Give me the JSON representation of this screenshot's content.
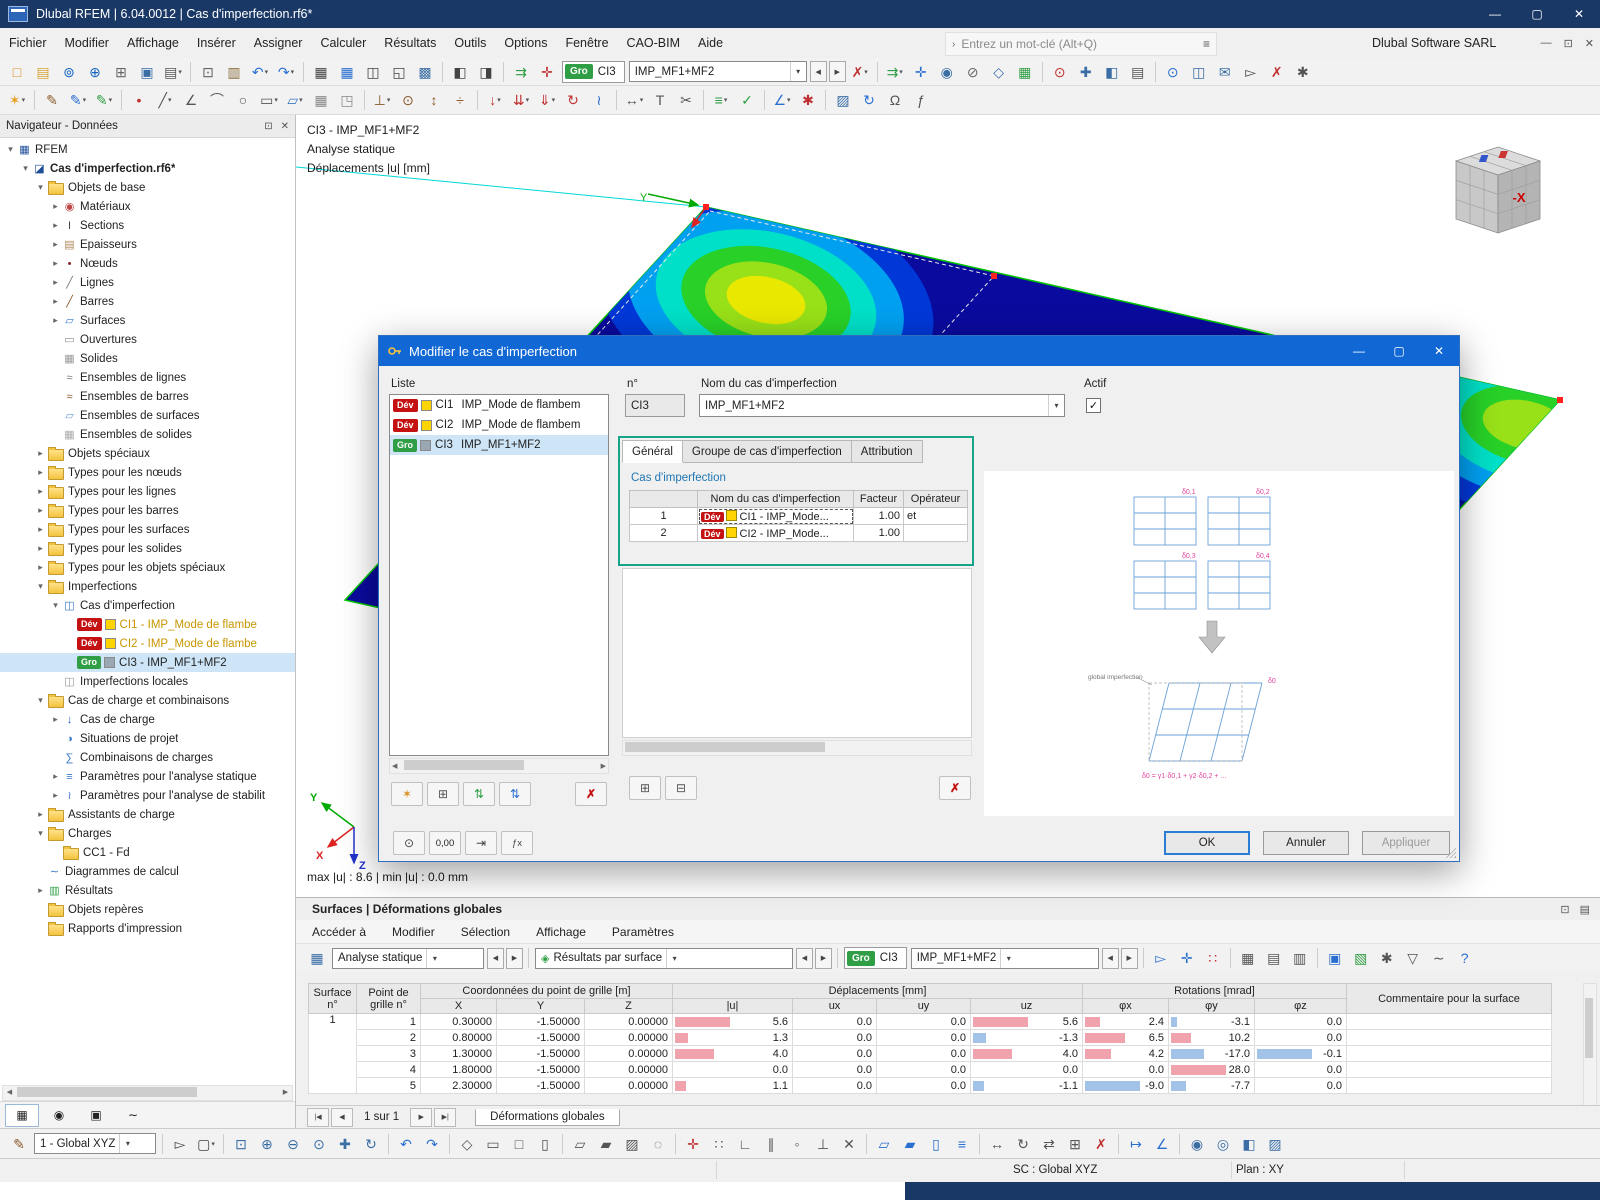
{
  "titlebar": {
    "title": "Dlubal RFEM | 6.04.0012 | Cas d'imperfection.rf6*"
  },
  "menubar": {
    "items": [
      "Fichier",
      "Modifier",
      "Affichage",
      "Insérer",
      "Assigner",
      "Calculer",
      "Résultats",
      "Outils",
      "Options",
      "Fenêtre",
      "CAO-BIM",
      "Aide"
    ],
    "search_placeholder": "Entrez un mot-clé (Alt+Q)",
    "brand": "Dlubal Software SARL"
  },
  "toolbar_combo": {
    "badge": "Gro",
    "id": "CI3",
    "name": "IMP_MF1+MF2"
  },
  "toolbars": {
    "t1a": [
      [
        "new-model",
        "□",
        "#d89020"
      ],
      [
        "open-model",
        "▤",
        "#d8a53a"
      ],
      [
        "teamwork",
        "⊚",
        "#1565c0"
      ],
      [
        "dlubal-center",
        "⊕",
        "#1565c0"
      ],
      [
        "copy-model",
        "⊞",
        "#666666"
      ],
      [
        "save-model",
        "▣",
        "#3a6ea5"
      ],
      [
        "print-graphic",
        "▤",
        "#555555",
        "dd"
      ],
      "|",
      [
        "copy-object",
        "⊡",
        "#666666"
      ],
      [
        "printout-report",
        "▥",
        "#8a6d3b"
      ],
      [
        "undo",
        "↶",
        "#2a6fd0",
        "dd"
      ],
      [
        "redo",
        "↷",
        "#2a6fd0",
        "dd"
      ],
      "|",
      [
        "table-view",
        "▦",
        "#444444"
      ],
      [
        "table-layout",
        "▦",
        "#2a6fd0"
      ],
      [
        "table-dock",
        "◫",
        "#444444"
      ],
      [
        "fullscreen",
        "◱",
        "#444444"
      ],
      [
        "snap-settings",
        "▩",
        "#3a6ea5"
      ],
      "|",
      [
        "navigator-toggle",
        "◧",
        "#444444"
      ],
      [
        "panel-toggle",
        "◨",
        "#444444"
      ],
      "|",
      [
        "load-direction",
        "⇉",
        "#2f9e44"
      ],
      [
        "axes-toggle",
        "✛",
        "#c03030"
      ]
    ],
    "t1b": [
      [
        "delete-results",
        "✗",
        "#c03030",
        "dd"
      ],
      "|",
      [
        "show-results",
        "⇉",
        "#2f9e44",
        "dd"
      ],
      [
        "result-values",
        "✛",
        "#2a6fd0"
      ],
      [
        "visibility",
        "◉",
        "#3a6ea5"
      ],
      [
        "clipping-box",
        "⊘",
        "#666666"
      ],
      [
        "user-view",
        "◇",
        "#3a6ea5"
      ],
      [
        "goto-table",
        "▦",
        "#2f9e44"
      ],
      "|",
      [
        "zoom-select",
        "⊙",
        "#c03030"
      ],
      [
        "move-view",
        "✚",
        "#3a6ea5"
      ],
      [
        "box-3d",
        "◧",
        "#3a6ea5"
      ],
      [
        "print-view",
        "▤",
        "#555555"
      ],
      "|",
      [
        "find-object",
        "⊙",
        "#2a6fd0"
      ],
      [
        "block-manager",
        "◫",
        "#3a6ea5"
      ],
      [
        "send-mail",
        "✉",
        "#3a6ea5"
      ],
      [
        "selection-pointer",
        "▻",
        "#444444"
      ],
      [
        "delete-all",
        "✗",
        "#c03030"
      ],
      [
        "options-gear",
        "✱",
        "#555555"
      ]
    ],
    "t2": [
      [
        "favorites",
        "✶",
        "#e8a020",
        "dd"
      ],
      "|",
      [
        "edit-node",
        "✎",
        "#8a5a2a"
      ],
      [
        "edit-line",
        "✎",
        "#2a6fd0",
        "dd"
      ],
      [
        "edit-surface",
        "✎",
        "#2f9e44",
        "dd"
      ],
      "|",
      [
        "new-node",
        "•",
        "#c03030"
      ],
      [
        "new-line",
        "╱",
        "#555555",
        "dd"
      ],
      [
        "new-polyline",
        "∠",
        "#555555"
      ],
      [
        "new-arc",
        "⌒",
        "#555555"
      ],
      [
        "new-circle",
        "○",
        "#555555"
      ],
      [
        "new-rectangle",
        "▭",
        "#555555",
        "dd"
      ],
      [
        "new-surface",
        "▱",
        "#3a78c8",
        "dd"
      ],
      [
        "new-solid",
        "▦",
        "#8a8a8a"
      ],
      [
        "new-opening",
        "◳",
        "#8a8a8a"
      ],
      "|",
      [
        "new-support",
        "⊥",
        "#8a5a2a",
        "dd"
      ],
      [
        "new-hinge",
        "⊙",
        "#8a5a2a"
      ],
      [
        "member-eccentricity",
        "↕",
        "#8a5a2a"
      ],
      [
        "member-division",
        "÷",
        "#8a5a2a"
      ],
      "|",
      [
        "nodal-load",
        "↓",
        "#c03030",
        "dd"
      ],
      [
        "line-load",
        "⇊",
        "#c03030",
        "dd"
      ],
      [
        "surface-load",
        "⇓",
        "#c03030",
        "dd"
      ],
      [
        "moment-load",
        "↻",
        "#c03030"
      ],
      [
        "imperfection-tool",
        "≀",
        "#2a6fd0"
      ],
      "|",
      [
        "dimension",
        "↔",
        "#555555",
        "dd"
      ],
      [
        "text-comment",
        "T",
        "#555555"
      ],
      [
        "section-cut",
        "✂",
        "#555555"
      ],
      "|",
      [
        "calculate-all",
        "≡",
        "#2f9e44",
        "dd"
      ],
      [
        "check-model",
        "✓",
        "#2f9e44"
      ],
      "|",
      [
        "measure",
        "∠",
        "#2a6fd0",
        "dd"
      ],
      [
        "default-settings",
        "✱",
        "#c03030"
      ],
      "|",
      [
        "display-properties",
        "▨",
        "#3a6ea5"
      ],
      [
        "regenerate",
        "↻",
        "#2a6fd0"
      ],
      [
        "units",
        "Ω",
        "#555555"
      ],
      [
        "formula",
        "ƒ",
        "#555555"
      ]
    ],
    "bt": [
      [
        "select-pointer",
        "▻",
        "#444444"
      ],
      [
        "select-window",
        "▢",
        "#444444",
        "dd"
      ],
      "|",
      [
        "zoom-window",
        "⊡",
        "#3a6ea5"
      ],
      [
        "zoom-in",
        "⊕",
        "#3a6ea5"
      ],
      [
        "zoom-out",
        "⊖",
        "#3a6ea5"
      ],
      [
        "zoom-all",
        "⊙",
        "#3a6ea5"
      ],
      [
        "pan-view",
        "✚",
        "#3a6ea5"
      ],
      [
        "orbit-view",
        "↻",
        "#3a6ea5"
      ],
      "|",
      [
        "previous-view",
        "↶",
        "#2a6fd0"
      ],
      [
        "next-view",
        "↷",
        "#2a6fd0"
      ],
      "|",
      [
        "view-isometric",
        "◇",
        "#555555"
      ],
      [
        "view-top",
        "▭",
        "#555555"
      ],
      [
        "view-front",
        "□",
        "#555555"
      ],
      [
        "view-side",
        "▯",
        "#555555"
      ],
      "|",
      [
        "display-wireframe",
        "▱",
        "#555555"
      ],
      [
        "display-shaded",
        "▰",
        "#555555"
      ],
      [
        "display-hidden",
        "▨",
        "#555555"
      ],
      [
        "display-transparent",
        "◌",
        "#555555"
      ],
      "|",
      [
        "snap-node",
        "✛",
        "#c03030"
      ],
      [
        "snap-grid",
        "∷",
        "#555555"
      ],
      [
        "snap-ortho",
        "∟",
        "#555555"
      ],
      [
        "snap-guidelines",
        "∥",
        "#555555"
      ],
      [
        "snap-midpoint",
        "◦",
        "#555555"
      ],
      [
        "snap-perpendicular",
        "⊥",
        "#555555"
      ],
      [
        "snap-intersection",
        "✕",
        "#555555"
      ],
      "|",
      [
        "work-plane-xy",
        "▱",
        "#2a6fd0"
      ],
      [
        "work-plane-xz",
        "▰",
        "#2a6fd0"
      ],
      [
        "work-plane-yz",
        "▯",
        "#2a6fd0"
      ],
      [
        "plane-offset",
        "≡",
        "#2a6fd0"
      ],
      "|",
      [
        "move-object",
        "↔",
        "#555555"
      ],
      [
        "rotate-object",
        "↻",
        "#555555"
      ],
      [
        "mirror-object",
        "⇄",
        "#555555"
      ],
      [
        "copy-object-2",
        "⊞",
        "#555555"
      ],
      [
        "delete-object",
        "✗",
        "#c03030"
      ],
      "|",
      [
        "measure-distance",
        "↦",
        "#2a6fd0"
      ],
      [
        "measure-angle",
        "∠",
        "#2a6fd0"
      ],
      "|",
      [
        "visibility-by-window",
        "◉",
        "#3a6ea5"
      ],
      [
        "visibility-by-object",
        "◎",
        "#3a6ea5"
      ],
      [
        "render-mode",
        "◧",
        "#3a6ea5"
      ],
      [
        "background-settings",
        "▨",
        "#3a6ea5"
      ]
    ],
    "rt": [
      [
        "result-pick",
        "▻",
        "#2a6fd0"
      ],
      [
        "result-pick-values",
        "✛",
        "#2a6fd0"
      ],
      [
        "pointer-values",
        "∷",
        "#c03030"
      ],
      "|",
      [
        "table-grid",
        "▦",
        "#555555"
      ],
      [
        "table-export",
        "▤",
        "#555555"
      ],
      [
        "table-print",
        "▥",
        "#555555"
      ],
      "|",
      [
        "table-save",
        "▣",
        "#2a6fd0"
      ],
      [
        "table-excel",
        "▧",
        "#2f9e44"
      ],
      [
        "table-settings",
        "✱",
        "#555555"
      ],
      [
        "table-filter",
        "▽",
        "#555555"
      ],
      [
        "table-chart",
        "∼",
        "#555555"
      ],
      [
        "table-help",
        "?",
        "#2a6fd0"
      ]
    ],
    "list_tb": [
      [
        "new-imperfection-case",
        "✶",
        "#d89020"
      ],
      [
        "copy-imperfection-case",
        "⊞",
        "#555555"
      ],
      [
        "check-all-cases",
        "⇅",
        "#2f9e44"
      ],
      [
        "sort-cases",
        "⇅",
        "#2a6fd0"
      ]
    ],
    "table_tb": [
      [
        "insert-row",
        "⊞",
        "#555555"
      ],
      [
        "remove-row",
        "⊟",
        "#555555"
      ]
    ]
  },
  "navigator": {
    "title": "Navigateur - Données",
    "tree": [
      {
        "t": "RFEM",
        "l": 0,
        "e": "v",
        "i": "rfem"
      },
      {
        "t": "Cas d'imperfection.rf6*",
        "l": 1,
        "e": "v",
        "i": "model",
        "bold": true
      },
      {
        "t": "Objets de base",
        "l": 2,
        "e": "v",
        "i": "folder"
      },
      {
        "t": "Matériaux",
        "l": 3,
        "e": "r",
        "i": "materials"
      },
      {
        "t": "Sections",
        "l": 3,
        "e": "r",
        "i": "sections"
      },
      {
        "t": "Épaisseurs",
        "l": 3,
        "e": "r",
        "i": "thickness"
      },
      {
        "t": "Nœuds",
        "l": 3,
        "e": "r",
        "i": "nodes"
      },
      {
        "t": "Lignes",
        "l": 3,
        "e": "r",
        "i": "lines"
      },
      {
        "t": "Barres",
        "l": 3,
        "e": "r",
        "i": "members"
      },
      {
        "t": "Surfaces",
        "l": 3,
        "e": "r",
        "i": "surfaces"
      },
      {
        "t": "Ouvertures",
        "l": 3,
        "e": "",
        "i": "openings"
      },
      {
        "t": "Solides",
        "l": 3,
        "e": "",
        "i": "solids"
      },
      {
        "t": "Ensembles de lignes",
        "l": 3,
        "e": "",
        "i": "setlines"
      },
      {
        "t": "Ensembles de barres",
        "l": 3,
        "e": "",
        "i": "setmembers"
      },
      {
        "t": "Ensembles de surfaces",
        "l": 3,
        "e": "",
        "i": "setsurfaces"
      },
      {
        "t": "Ensembles de solides",
        "l": 3,
        "e": "",
        "i": "setsolids"
      },
      {
        "t": "Objets spéciaux",
        "l": 2,
        "e": "r",
        "i": "folder"
      },
      {
        "t": "Types pour les nœuds",
        "l": 2,
        "e": "r",
        "i": "folder"
      },
      {
        "t": "Types pour les lignes",
        "l": 2,
        "e": "r",
        "i": "folder"
      },
      {
        "t": "Types pour les barres",
        "l": 2,
        "e": "r",
        "i": "folder"
      },
      {
        "t": "Types pour les surfaces",
        "l": 2,
        "e": "r",
        "i": "folder"
      },
      {
        "t": "Types pour les solides",
        "l": 2,
        "e": "r",
        "i": "folder"
      },
      {
        "t": "Types pour les objets spéciaux",
        "l": 2,
        "e": "r",
        "i": "folder"
      },
      {
        "t": "Imperfections",
        "l": 2,
        "e": "v",
        "i": "folder"
      },
      {
        "t": "Cas d'imperfection",
        "l": 3,
        "e": "v",
        "i": "impcase"
      },
      {
        "t": "CI1 - IMP_Mode de flambe",
        "l": 4,
        "b": "Dév",
        "bc": "#c41212",
        "sq": "#ffd400",
        "col": "#c79600"
      },
      {
        "t": "CI2 - IMP_Mode de flambe",
        "l": 4,
        "b": "Dév",
        "bc": "#c41212",
        "sq": "#ffd400",
        "col": "#c79600"
      },
      {
        "t": "CI3 - IMP_MF1+MF2",
        "l": 4,
        "b": "Gro",
        "bc": "#2f9e44",
        "sq": "#9aa7b3",
        "sel": true
      },
      {
        "t": "Imperfections locales",
        "l": 3,
        "e": "",
        "i": "implocal"
      },
      {
        "t": "Cas de charge et combinaisons",
        "l": 2,
        "e": "v",
        "i": "folder"
      },
      {
        "t": "Cas de charge",
        "l": 3,
        "e": "r",
        "i": "loadcase"
      },
      {
        "t": "Situations de projet",
        "l": 3,
        "e": "",
        "i": "situations"
      },
      {
        "t": "Combinaisons de charges",
        "l": 3,
        "e": "",
        "i": "combos"
      },
      {
        "t": "Paramètres pour l'analyse statique",
        "l": 3,
        "e": "r",
        "i": "params"
      },
      {
        "t": "Paramètres pour l'analyse de stabilit",
        "l": 3,
        "e": "r",
        "i": "stability"
      },
      {
        "t": "Assistants de charge",
        "l": 2,
        "e": "r",
        "i": "folder"
      },
      {
        "t": "Charges",
        "l": 2,
        "e": "v",
        "i": "folder"
      },
      {
        "t": "CC1 - Fd",
        "l": 3,
        "e": "",
        "i": "folder"
      },
      {
        "t": "Diagrammes de calcul",
        "l": 2,
        "e": "",
        "i": "diagram"
      },
      {
        "t": "Résultats",
        "l": 2,
        "e": "r",
        "i": "results"
      },
      {
        "t": "Objets repères",
        "l": 2,
        "e": "",
        "i": "folder"
      },
      {
        "t": "Rapports d'impression",
        "l": 2,
        "e": "",
        "i": "folder"
      }
    ]
  },
  "viewport": {
    "info": [
      "CI3 - IMP_MF1+MF2",
      "Analyse statique",
      "Déplacements |u| [mm]"
    ],
    "minmax": "max |u| : 8.6 | min |u| : 0.0 mm",
    "cube_face_label": "-X",
    "axis_x": "X",
    "axis_y": "Y",
    "axis_z": "Z"
  },
  "dialog": {
    "title": "Modifier le cas d'imperfection",
    "liste_label": "Liste",
    "list": [
      {
        "badge": "Dév",
        "bc": "#c41212",
        "sw": "#ffd400",
        "id": "CI1",
        "name": "IMP_Mode de flambem"
      },
      {
        "badge": "Dév",
        "bc": "#c41212",
        "sw": "#ffd400",
        "id": "CI2",
        "name": "IMP_Mode de flambem"
      },
      {
        "badge": "Gro",
        "bc": "#2f9e44",
        "sw": "#9aa7b3",
        "id": "CI3",
        "name": "IMP_MF1+MF2",
        "sel": true
      }
    ],
    "no_label": "n°",
    "no_value": "CI3",
    "name_label": "Nom du cas d'imperfection",
    "name_value": "IMP_MF1+MF2",
    "actif_label": "Actif",
    "tabs": [
      "Général",
      "Groupe de cas d'imperfection",
      "Attribution"
    ],
    "section_title": "Cas d'imperfection",
    "table": {
      "headers": [
        "Nom du cas d'imperfection",
        "Facteur",
        "Opérateur"
      ],
      "rows": [
        {
          "no": "1",
          "badge": "Dév",
          "name": "CI1 - IMP_Mode...",
          "facteur": "1.00",
          "operateur": "et"
        },
        {
          "no": "2",
          "badge": "Dév",
          "name": "CI2 - IMP_Mode...",
          "facteur": "1.00",
          "operateur": ""
        }
      ]
    },
    "diagram": {
      "labels": [
        "δ0,1",
        "δ0,2",
        "δ0,3",
        "δ0,4"
      ],
      "global_label": "global imperfection",
      "delta": "δ0",
      "formula": "δ0 = γ1·δ0,1 + γ2·δ0,2 + ..."
    },
    "decimals_label": "0,00",
    "buttons": {
      "ok": "OK",
      "cancel": "Annuler",
      "apply": "Appliquer"
    }
  },
  "results": {
    "panel_title": "Surfaces | Déformations globales",
    "menu": [
      "Accéder à",
      "Modifier",
      "Sélection",
      "Affichage",
      "Paramètres"
    ],
    "combo_analysis": "Analyse statique",
    "combo_result_type": "Résultats par surface",
    "case_badge": "Gro",
    "case_id": "CI3",
    "combo_case": "IMP_MF1+MF2",
    "table": {
      "surface_h1": "Surface",
      "surface_h2": "n°",
      "point_h1": "Point de",
      "point_h2": "grille n°",
      "group_coords": "Coordonnées du point de grille [m]",
      "group_depl": "Déplacements [mm]",
      "group_rot": "Rotations [mrad]",
      "group_comment": "Commentaire pour la surface",
      "cols": [
        "X",
        "Y",
        "Z",
        "|u|",
        "ux",
        "uy",
        "uz",
        "φx",
        "φy",
        "φz"
      ],
      "surface_no": "1",
      "rows": [
        {
          "point": "1",
          "x": "0.30000",
          "y": "-1.50000",
          "z": "0.00000",
          "u": 5.6,
          "ux": 0.0,
          "uy": 0.0,
          "uz": 5.6,
          "phix": 2.4,
          "phiy": -3.1,
          "phiz": 0.0
        },
        {
          "point": "2",
          "x": "0.80000",
          "y": "-1.50000",
          "z": "0.00000",
          "u": 1.3,
          "ux": 0.0,
          "uy": 0.0,
          "uz": -1.3,
          "phix": 6.5,
          "phiy": 10.2,
          "phiz": 0.0
        },
        {
          "point": "3",
          "x": "1.30000",
          "y": "-1.50000",
          "z": "0.00000",
          "u": 4.0,
          "ux": 0.0,
          "uy": 0.0,
          "uz": 4.0,
          "phix": 4.2,
          "phiy": -17.0,
          "phiz": -0.1
        },
        {
          "point": "4",
          "x": "1.80000",
          "y": "-1.50000",
          "z": "0.00000",
          "u": 0.0,
          "ux": 0.0,
          "uy": 0.0,
          "uz": 0.0,
          "phix": 0.0,
          "phiy": 28.0,
          "phiz": 0.0
        },
        {
          "point": "5",
          "x": "2.30000",
          "y": "-1.50000",
          "z": "0.00000",
          "u": 1.1,
          "ux": 0.0,
          "uy": 0.0,
          "uz": -1.1,
          "phix": -9.0,
          "phiy": -7.7,
          "phiz": 0.0
        }
      ],
      "bar_positive_color": "#f0a3ad",
      "bar_negative_color": "#a3c2e8"
    },
    "pagination": "1 sur 1",
    "sheet_tab": "Déformations globales"
  },
  "bottombar": {
    "view_combo": "1 - Global XYZ"
  },
  "statusbar": {
    "sc": "SC : Global XYZ",
    "plan": "Plan : XY"
  }
}
